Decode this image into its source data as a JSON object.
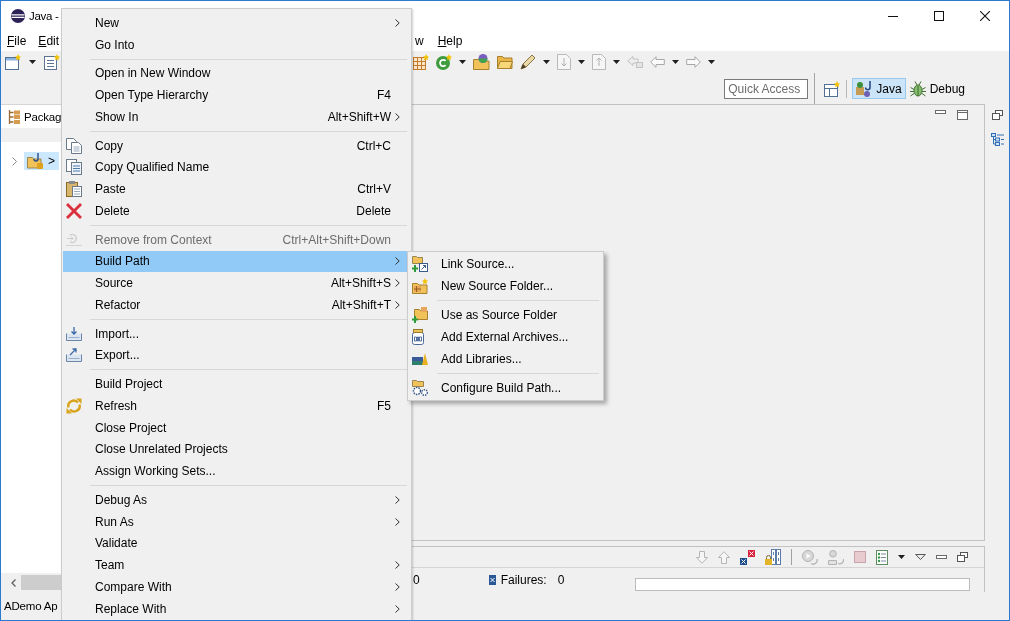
{
  "window": {
    "title": "Java -"
  },
  "menubar": [
    {
      "label": "File",
      "mnemonic": true
    },
    {
      "label": "Edit",
      "mnemonic": true
    },
    {
      "label": "w",
      "mnemonic": false
    },
    {
      "label": "Help",
      "mnemonic": true
    }
  ],
  "toolbar": {
    "quick_access": {
      "placeholder": "Quick Access"
    },
    "perspectives": [
      {
        "label": "Java",
        "selected": true
      },
      {
        "label": "Debug",
        "selected": false
      }
    ]
  },
  "package_explorer": {
    "tab": {
      "label": "Packag",
      "selected": true
    },
    "tree": [
      {
        "label": ">",
        "selected": true,
        "expanded": false
      }
    ]
  },
  "junit": {
    "counters": [
      {
        "value": "0"
      },
      {
        "label": "Failures:",
        "value": "0"
      }
    ],
    "progress": {
      "level": 0
    }
  },
  "status_bar": {
    "text": "ADemo Ap"
  },
  "context_menu": {
    "groups": [
      [
        {
          "label": "New",
          "submenu": true,
          "selected": false,
          "disabled": false
        },
        {
          "label": "Go Into",
          "submenu": false,
          "selected": false,
          "disabled": false
        }
      ],
      [
        {
          "label": "Open in New Window",
          "submenu": false,
          "selected": false,
          "disabled": false
        },
        {
          "label": "Open Type Hierarchy",
          "shortcut": "F4",
          "submenu": false,
          "selected": false,
          "disabled": false
        },
        {
          "label": "Show In",
          "shortcut": "Alt+Shift+W",
          "submenu": true,
          "selected": false,
          "disabled": false
        }
      ],
      [
        {
          "label": "Copy",
          "shortcut": "Ctrl+C",
          "submenu": false,
          "selected": false,
          "disabled": false
        },
        {
          "label": "Copy Qualified Name",
          "submenu": false,
          "selected": false,
          "disabled": false
        },
        {
          "label": "Paste",
          "shortcut": "Ctrl+V",
          "submenu": false,
          "selected": false,
          "disabled": false
        },
        {
          "label": "Delete",
          "shortcut": "Delete",
          "submenu": false,
          "selected": false,
          "disabled": false
        }
      ],
      [
        {
          "label": "Remove from Context",
          "shortcut": "Ctrl+Alt+Shift+Down",
          "submenu": false,
          "selected": false,
          "disabled": true
        },
        {
          "label": "Build Path",
          "submenu": true,
          "selected": true,
          "disabled": false
        },
        {
          "label": "Source",
          "shortcut": "Alt+Shift+S",
          "submenu": true,
          "selected": false,
          "disabled": false
        },
        {
          "label": "Refactor",
          "shortcut": "Alt+Shift+T",
          "submenu": true,
          "selected": false,
          "disabled": false
        }
      ],
      [
        {
          "label": "Import...",
          "submenu": false,
          "selected": false,
          "disabled": false
        },
        {
          "label": "Export...",
          "submenu": false,
          "selected": false,
          "disabled": false
        }
      ],
      [
        {
          "label": "Build Project",
          "submenu": false,
          "selected": false,
          "disabled": false
        },
        {
          "label": "Refresh",
          "shortcut": "F5",
          "submenu": false,
          "selected": false,
          "disabled": false
        },
        {
          "label": "Close Project",
          "submenu": false,
          "selected": false,
          "disabled": false
        },
        {
          "label": "Close Unrelated Projects",
          "submenu": false,
          "selected": false,
          "disabled": false
        },
        {
          "label": "Assign Working Sets...",
          "submenu": false,
          "selected": false,
          "disabled": false
        }
      ],
      [
        {
          "label": "Debug As",
          "submenu": true,
          "selected": false,
          "disabled": false
        },
        {
          "label": "Run As",
          "submenu": true,
          "selected": false,
          "disabled": false
        },
        {
          "label": "Validate",
          "submenu": false,
          "selected": false,
          "disabled": false
        },
        {
          "label": "Team",
          "submenu": true,
          "selected": false,
          "disabled": false
        },
        {
          "label": "Compare With",
          "submenu": true,
          "selected": false,
          "disabled": false
        },
        {
          "label": "Replace With",
          "submenu": true,
          "selected": false,
          "disabled": false
        }
      ]
    ]
  },
  "build_path_submenu": {
    "groups": [
      [
        {
          "label": "Link Source...",
          "selected": false,
          "disabled": false
        },
        {
          "label": "New Source Folder...",
          "selected": false,
          "disabled": false
        }
      ],
      [
        {
          "label": "Use as Source Folder",
          "selected": false,
          "disabled": false
        },
        {
          "label": "Add External Archives...",
          "selected": false,
          "disabled": false
        },
        {
          "label": "Add Libraries...",
          "selected": false,
          "disabled": false
        }
      ],
      [
        {
          "label": "Configure Build Path...",
          "selected": false,
          "disabled": false
        }
      ]
    ]
  }
}
